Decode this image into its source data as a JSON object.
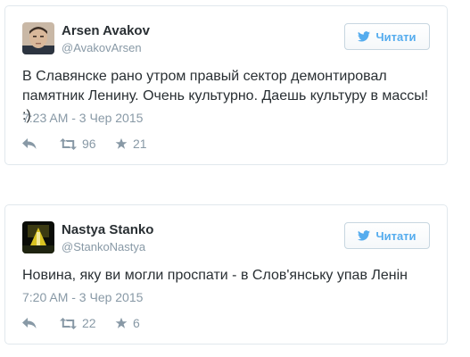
{
  "tweets": [
    {
      "name": "Arsen Avakov",
      "handle": "@AvakovArsen",
      "follow_label": "Читати",
      "text": "В Славянске рано утром правый сектор демонтировал памятник Ленину. Очень культурно. Даешь культуру в массы! :)",
      "date": "7:23 AM - 3 Чер 2015",
      "retweets": "96",
      "favorites": "21"
    },
    {
      "name": "Nastya Stanko",
      "handle": "@StankoNastya",
      "follow_label": "Читати",
      "text": "Новина, яку ви могли проспати - в Слов'янську упав Ленін",
      "date": "7:20 AM - 3 Чер 2015",
      "retweets": "22",
      "favorites": "6"
    }
  ],
  "icons": {
    "follow": "twitter-bird-icon",
    "reply": "reply-arrow-icon",
    "retweet": "retweet-icon",
    "favorite": "star-icon"
  },
  "colors": {
    "accent": "#55acee",
    "muted": "#8899a6",
    "text": "#292f33",
    "border": "#e1e8ed"
  }
}
